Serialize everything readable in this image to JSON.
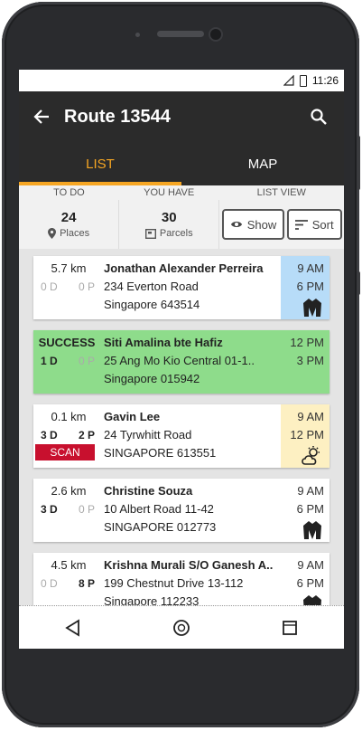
{
  "status_bar": {
    "time": "11:26"
  },
  "app_bar": {
    "title": "Route 13544"
  },
  "tabs": [
    {
      "label": "LIST",
      "active": true
    },
    {
      "label": "MAP",
      "active": false
    }
  ],
  "summary": {
    "headers": {
      "to_do": "TO DO",
      "you_have": "YOU HAVE",
      "list_view": "LIST VIEW"
    },
    "places": {
      "count": "24",
      "label": "Places"
    },
    "parcels": {
      "count": "30",
      "label": "Parcels"
    },
    "show_label": "Show",
    "sort_label": "Sort"
  },
  "stops": [
    {
      "distance": "5.7 km",
      "d": "0 D",
      "p": "0 P",
      "name": "Jonathan Alexander Perreira",
      "address": "234 Everton Road",
      "city": "Singapore 643514",
      "time_from": "9 AM",
      "time_to": "6 PM",
      "time_color": "#b7dcf8",
      "icon": "jacket-icon"
    },
    {
      "distance": "SUCCESS",
      "d": "1 D",
      "p": "0 P",
      "name": "Siti Amalina bte Hafiz",
      "address": "25 Ang Mo Kio Central 01-1..",
      "city": "Singapore 015942",
      "time_from": "12 PM",
      "time_to": "3 PM",
      "card_color": "#8edc8b"
    },
    {
      "distance": "0.1 km",
      "d": "3 D",
      "p": "2 P",
      "name": "Gavin Lee",
      "address": "24 Tyrwhitt Road",
      "city": "SINGAPORE 613551",
      "badge": "SCAN",
      "time_from": "9 AM",
      "time_to": "12 PM",
      "time_color": "#fdf0c2",
      "icon": "partly-cloudy-icon"
    },
    {
      "distance": "2.6 km",
      "d": "3 D",
      "p": "0 P",
      "name": "Christine Souza",
      "address": "10 Albert Road 11-42",
      "city": "SINGAPORE 012773",
      "time_from": "9 AM",
      "time_to": "6 PM",
      "icon": "jacket-icon"
    },
    {
      "distance": "4.5 km",
      "d": "0 D",
      "p": "8 P",
      "name": "Krishna Murali S/O Ganesh A..",
      "address": "199 Chestnut Drive 13-112",
      "city": "Singapore 112233",
      "time_from": "9 AM",
      "time_to": "6 PM",
      "icon": "jacket-icon"
    }
  ],
  "colors": {
    "accent": "#f6a623",
    "appbar": "#2b2b2b",
    "scan": "#c8102e",
    "success": "#8edc8b"
  }
}
